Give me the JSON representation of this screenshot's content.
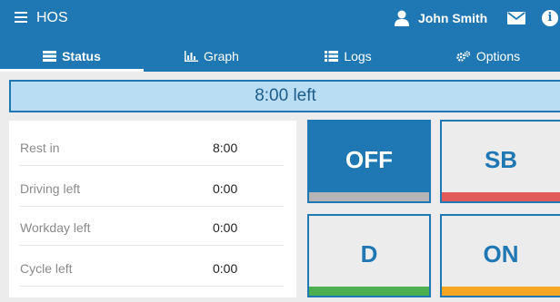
{
  "app": {
    "title": "HOS"
  },
  "user": {
    "name": "John Smith"
  },
  "tabs": [
    {
      "label": "Status",
      "icon": "status-icon",
      "active": true
    },
    {
      "label": "Graph",
      "icon": "bar-chart-icon",
      "active": false
    },
    {
      "label": "Logs",
      "icon": "list-icon",
      "active": false
    },
    {
      "label": "Options",
      "icon": "gears-icon",
      "active": false
    }
  ],
  "banner": {
    "text": "8:00 left"
  },
  "stats": [
    {
      "label": "Rest in",
      "value": "8:00"
    },
    {
      "label": "Driving left",
      "value": "0:00"
    },
    {
      "label": "Workday left",
      "value": "0:00"
    },
    {
      "label": "Cycle left",
      "value": "0:00"
    }
  ],
  "duty_status": [
    {
      "label": "OFF",
      "bar_color": "#b5b5b5",
      "active": true
    },
    {
      "label": "SB",
      "bar_color": "#e25b5b",
      "active": false
    },
    {
      "label": "D",
      "bar_color": "#4caf50",
      "active": false
    },
    {
      "label": "ON",
      "bar_color": "#f5a623",
      "active": false
    }
  ],
  "colors": {
    "primary": "#1f78b4",
    "banner_bg": "#b9ddf3"
  }
}
